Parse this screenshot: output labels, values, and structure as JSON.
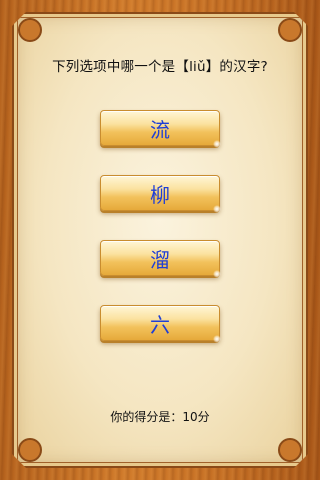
{
  "question": "下列选项中哪一个是【liǔ】的汉字?",
  "options": [
    {
      "label": "流"
    },
    {
      "label": "柳"
    },
    {
      "label": "溜"
    },
    {
      "label": "六"
    }
  ],
  "score_text": "你的得分是：10分",
  "colors": {
    "option_text": "#1f3fd6",
    "button_gold": "#f2c25c",
    "wood": "#c56f24",
    "parchment": "#f5e6c2"
  }
}
